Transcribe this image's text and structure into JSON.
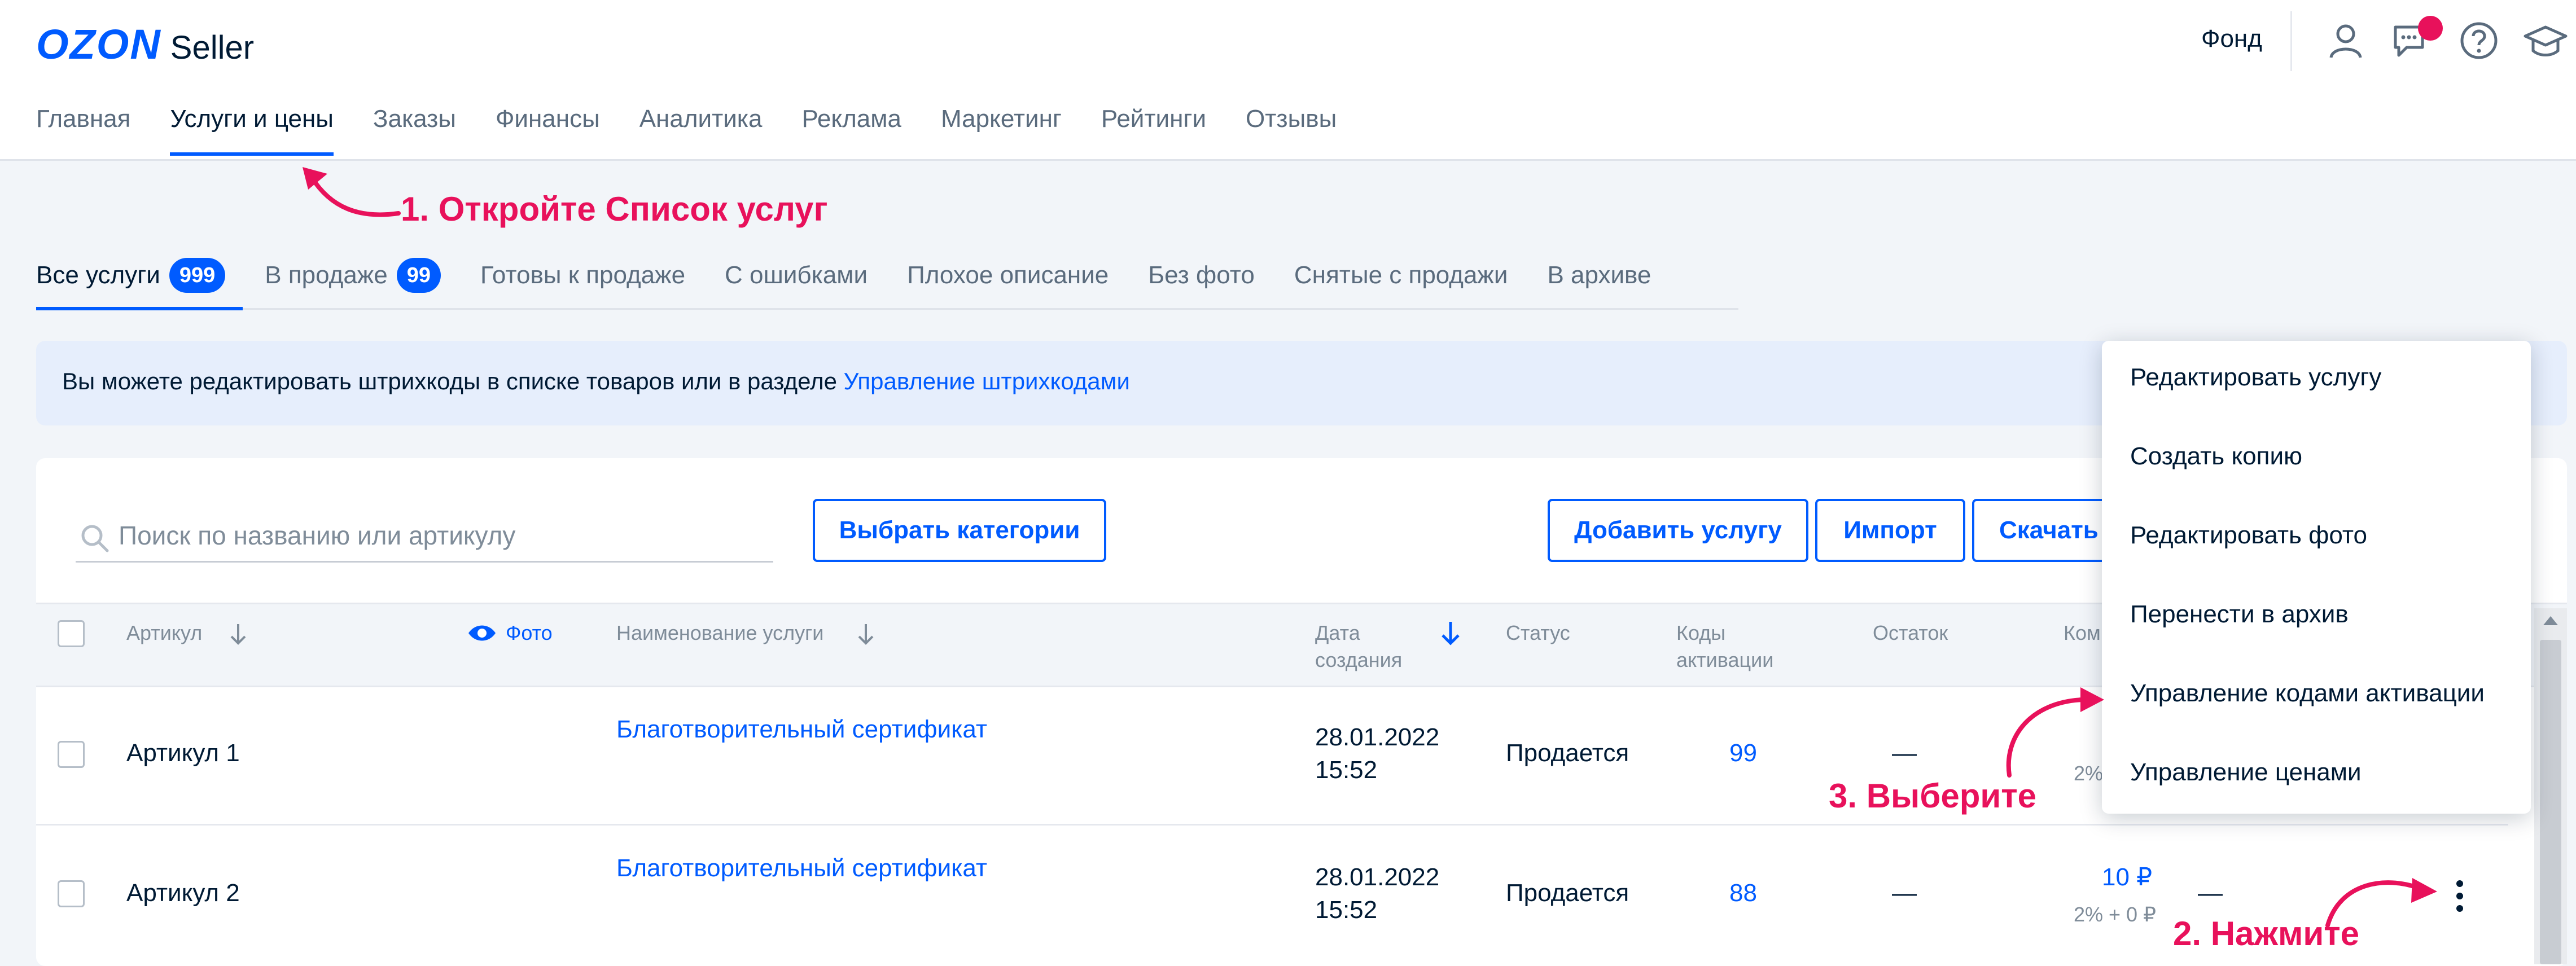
{
  "header": {
    "logo_main": "OZON",
    "logo_sub": "Seller",
    "fund": "Фонд",
    "icons": [
      "user-icon",
      "chat-icon",
      "help-icon",
      "education-icon"
    ]
  },
  "nav": {
    "items": [
      "Главная",
      "Услуги и цены",
      "Заказы",
      "Финансы",
      "Аналитика",
      "Реклама",
      "Маркетинг",
      "Рейтинги",
      "Отзывы"
    ],
    "active_index": 1
  },
  "annotations": {
    "step1": "1. Откройте Список услуг",
    "step2": "2. Нажмите",
    "step3": "3. Выберите"
  },
  "tabs": {
    "all": {
      "label": "Все услуги",
      "count": "999"
    },
    "on_sale": {
      "label": "В продаже",
      "count": "99"
    },
    "ready": "Готовы к продаже",
    "errors": "С ошибками",
    "bad_desc": "Плохое описание",
    "no_photo": "Без фото",
    "removed": "Снятые с продажи",
    "archive": "В архиве"
  },
  "banner": {
    "text": "Вы можете редактировать штрихкоды в списке товаров или в разделе ",
    "link": "Управление штрихкодами"
  },
  "toolbar": {
    "search_placeholder": "Поиск по названию или артикулу",
    "choose_categories": "Выбрать категории",
    "add_service": "Добавить услугу",
    "import": "Импорт",
    "download": "Скачать"
  },
  "table": {
    "columns": {
      "article": "Артикул",
      "photo": "Фото",
      "name": "Наименование услуги",
      "date_line1": "Дата",
      "date_line2": "создания",
      "status": "Статус",
      "codes_line1": "Коды",
      "codes_line2": "активации",
      "stock": "Остаток",
      "commission": "Ком"
    },
    "rows": [
      {
        "article": "Артикул 1",
        "name": "Благотворительный сертификат",
        "date": "28.01.2022",
        "time": "15:52",
        "status": "Продается",
        "codes": "99",
        "stock": "—",
        "commission_sub": "2%"
      },
      {
        "article": "Артикул 2",
        "name": "Благотворительный сертификат",
        "date": "28.01.2022",
        "time": "15:52",
        "status": "Продается",
        "codes": "88",
        "stock": "—",
        "price": "10 ₽",
        "commission_sub": "2% + 0 ₽",
        "extra": "—"
      }
    ]
  },
  "menu": {
    "items": [
      "Редактировать услугу",
      "Создать копию",
      "Редактировать фото",
      "Перенести в архив",
      "Управление кодами активации",
      "Управление ценами"
    ]
  },
  "colors": {
    "accent": "#005bff",
    "annotation": "#e8115b",
    "notification": "#e8115b"
  }
}
